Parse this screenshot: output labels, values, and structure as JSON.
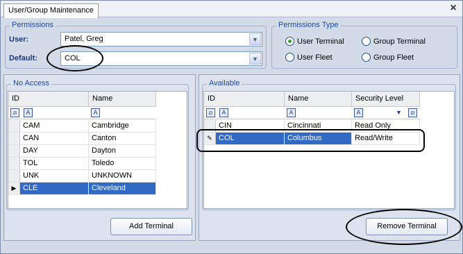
{
  "window": {
    "tab_label": "User/Group Maintenance",
    "close_label": "×"
  },
  "permissions": {
    "title": "Permissions",
    "user_label": "User:",
    "user_value": "Patel, Greg",
    "default_label": "Default:",
    "default_value": "COL"
  },
  "permissions_type": {
    "title": "Permissions Type",
    "options": [
      {
        "label": "User Terminal",
        "selected": true
      },
      {
        "label": "Group Terminal",
        "selected": false
      },
      {
        "label": "User Fleet",
        "selected": false
      },
      {
        "label": "Group Fleet",
        "selected": false
      }
    ]
  },
  "no_access": {
    "title": "No Access",
    "columns": [
      "ID",
      "Name"
    ],
    "rows": [
      {
        "id": "CAM",
        "name": "Cambridge"
      },
      {
        "id": "CAN",
        "name": "Canton"
      },
      {
        "id": "DAY",
        "name": "Dayton"
      },
      {
        "id": "TOL",
        "name": "Toledo"
      },
      {
        "id": "UNK",
        "name": "UNKNOWN"
      },
      {
        "id": "CLE",
        "name": "Cleveland"
      }
    ],
    "add_button": "Add Terminal"
  },
  "available": {
    "title": "Available",
    "columns": [
      "ID",
      "Name",
      "Security Level"
    ],
    "rows": [
      {
        "id": "CIN",
        "name": "Cincinnati",
        "level": "Read Only"
      },
      {
        "id": "COL",
        "name": "Columbus",
        "level": "Read/Write"
      }
    ],
    "remove_button": "Remove Terminal"
  },
  "colors": {
    "accent": "#1a4aa8",
    "selection": "#316ac5",
    "radio_on": "#2aa52a"
  }
}
